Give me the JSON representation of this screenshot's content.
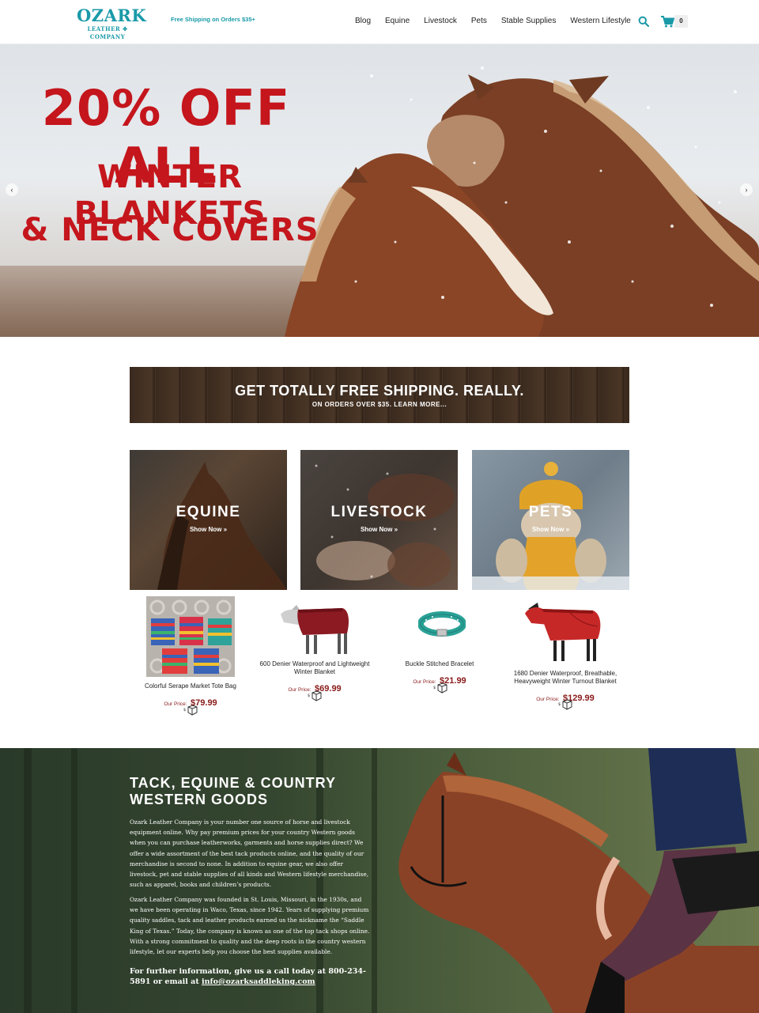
{
  "header": {
    "logo_main": "OZARK",
    "logo_sub": "LEATHER ✤ COMPANY",
    "shipping_note": "Free Shipping on Orders $35+",
    "nav": [
      "Blog",
      "Equine",
      "Livestock",
      "Pets",
      "Stable Supplies",
      "Western Lifestyle"
    ],
    "cart_count": "0",
    "icons": [
      "search-icon",
      "cart-icon"
    ]
  },
  "hero": {
    "line1": "20% OFF ALL",
    "line2": "WINTER BLANKETS",
    "line3": "& NECK COVERS",
    "prev_arrow": "‹",
    "next_arrow": "›"
  },
  "banner": {
    "title": "GET TOTALLY FREE SHIPPING. REALLY.",
    "subtitle": "ON ORDERS OVER $35. LEARN MORE..."
  },
  "categories": [
    {
      "title": "EQUINE",
      "link": "Show Now »"
    },
    {
      "title": "LIVESTOCK",
      "link": "Show Now »"
    },
    {
      "title": "PETS",
      "link": "Show Now »"
    }
  ],
  "products": [
    {
      "name": "Colorful Serape Market Tote Bag",
      "price_label": "Our Price:",
      "price": "$79.99"
    },
    {
      "name": "600 Denier Waterproof and Lightweight Winter Blanket",
      "price_label": "Our Price:",
      "price": "$69.99"
    },
    {
      "name": "Buckle Stitched Bracelet",
      "price_label": "Our Price:",
      "price": "$21.99"
    },
    {
      "name": "1680 Denier Waterproof, Breathable, Heavyweight Winter Turnout Blanket",
      "price_label": "Our Price:",
      "price": "$129.99"
    }
  ],
  "about": {
    "title": "TACK, EQUINE & COUNTRY WESTERN GOODS",
    "p1": "Ozark Leather Company is your number one source of horse and livestock equipment online. Why pay premium prices for your country Western goods when you can purchase leatherworks, garments and horse supplies direct? We offer a wide assortment of the best tack products online, and the quality of our merchandise is second to none. In addition to equine gear, we also offer livestock, pet and stable supplies of all kinds and Western lifestyle merchandise, such as apparel, books and children’s products.",
    "p2": "Ozark Leather Company was founded in St. Louis, Missouri, in the 1930s, and we have been operating in Waco, Texas, since 1942. Years of supplying premium quality saddles, tack and leather products earned us the nickname the “Saddle King of Texas.” Today, the company is known as one of the top tack shops online. With a strong commitment to quality and the deep roots in the country western lifestyle, let our experts help you choose the best supplies available.",
    "contact_text": "For further information, give us a call today at 800-234-5891 or email at ",
    "contact_email": "info@ozarksaddleking.com"
  }
}
